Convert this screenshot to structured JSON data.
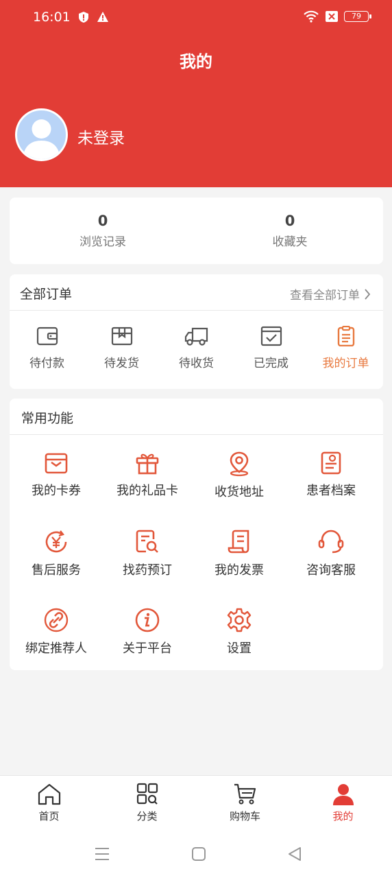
{
  "status": {
    "time": "16:01",
    "battery": "79"
  },
  "header": {
    "title": "我的",
    "login_text": "未登录"
  },
  "stats": [
    {
      "num": "0",
      "label": "浏览记录"
    },
    {
      "num": "0",
      "label": "收藏夹"
    }
  ],
  "orders": {
    "title": "全部订单",
    "view_all": "查看全部订单",
    "items": [
      {
        "label": "待付款",
        "icon": "wallet-icon"
      },
      {
        "label": "待发货",
        "icon": "package-icon"
      },
      {
        "label": "待收货",
        "icon": "truck-icon"
      },
      {
        "label": "已完成",
        "icon": "check-box-icon"
      },
      {
        "label": "我的订单",
        "icon": "clipboard-icon"
      }
    ]
  },
  "functions": {
    "title": "常用功能",
    "items": [
      {
        "label": "我的卡券",
        "icon": "coupon-icon"
      },
      {
        "label": "我的礼品卡",
        "icon": "gift-icon"
      },
      {
        "label": "收货地址",
        "icon": "location-pin-icon"
      },
      {
        "label": "患者档案",
        "icon": "medical-record-icon"
      },
      {
        "label": "售后服务",
        "icon": "yuan-refresh-icon"
      },
      {
        "label": "找药预订",
        "icon": "search-document-icon"
      },
      {
        "label": "我的发票",
        "icon": "invoice-icon"
      },
      {
        "label": "咨询客服",
        "icon": "headset-icon"
      },
      {
        "label": "绑定推荐人",
        "icon": "link-icon"
      },
      {
        "label": "关于平台",
        "icon": "info-icon"
      },
      {
        "label": "设置",
        "icon": "gear-icon"
      }
    ]
  },
  "tabbar": [
    {
      "label": "首页",
      "icon": "home-icon"
    },
    {
      "label": "分类",
      "icon": "category-icon"
    },
    {
      "label": "购物车",
      "icon": "cart-icon"
    },
    {
      "label": "我的",
      "icon": "user-icon"
    }
  ],
  "colors": {
    "brand": "#e23d36",
    "accent": "#e8793f",
    "background": "#f4f4f4"
  }
}
